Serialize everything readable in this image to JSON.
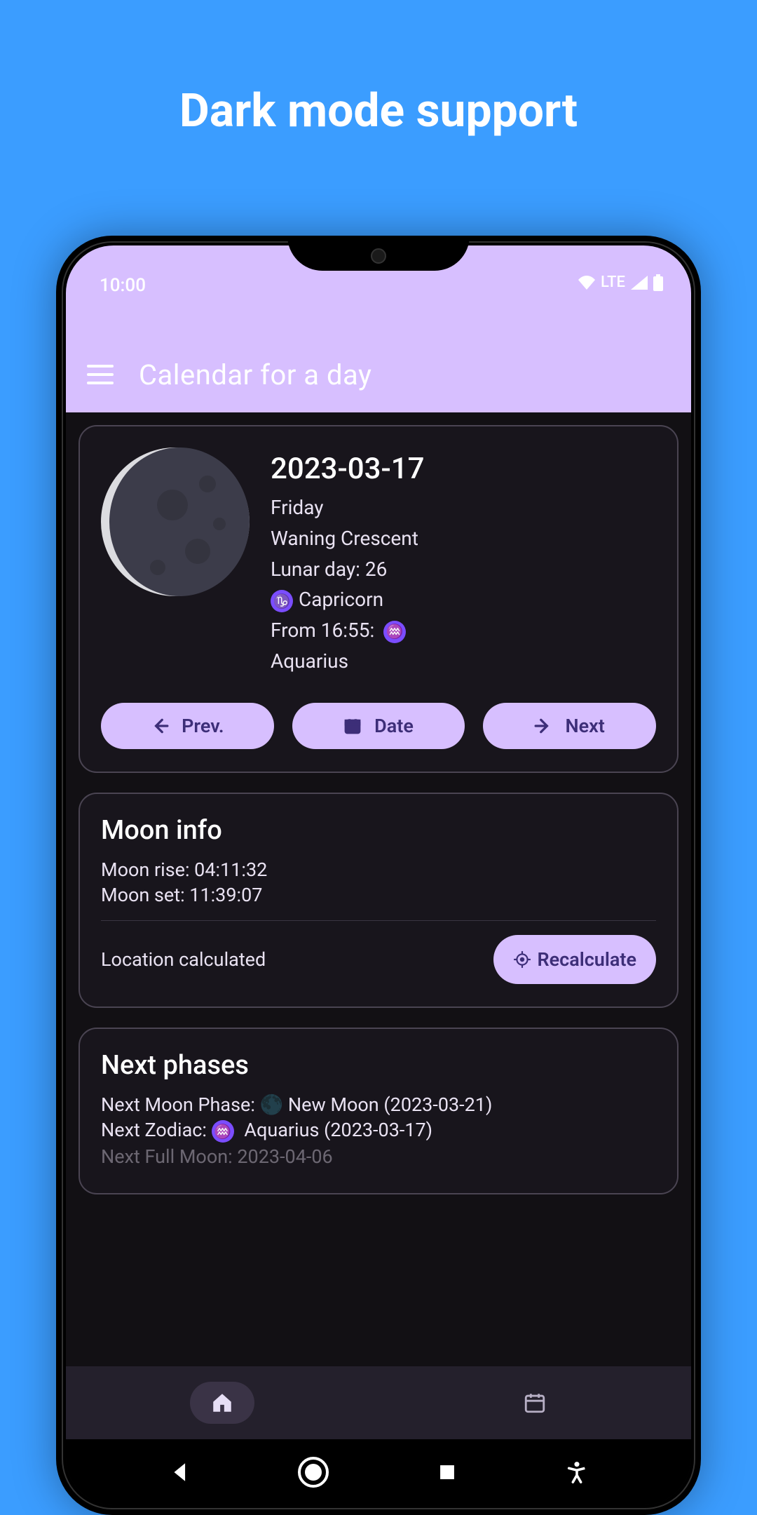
{
  "promo": {
    "title": "Dark mode support"
  },
  "status": {
    "time": "10:00",
    "network": "LTE"
  },
  "appbar": {
    "title": "Calendar for a day"
  },
  "day": {
    "date": "2023-03-17",
    "weekday": "Friday",
    "phase": "Waning Crescent",
    "lunar_day_label": "Lunar day: 26",
    "zodiac": "Capricorn",
    "from_time_label": "From 16:55:",
    "next_zodiac": "Aquarius"
  },
  "buttons": {
    "prev": "Prev.",
    "date": "Date",
    "next": "Next"
  },
  "moon_info": {
    "heading": "Moon info",
    "rise": "Moon rise: 04:11:32",
    "set": "Moon set: 11:39:07",
    "location": "Location calculated",
    "recalc": "Recalculate"
  },
  "next_phases": {
    "heading": "Next phases",
    "line1": "Next Moon Phase: 🌑 New Moon (2023-03-21)",
    "line2_a": "Next Zodiac: ",
    "line2_b": " Aquarius (2023-03-17)",
    "line3": "Next Full Moon: 2023-04-06"
  }
}
